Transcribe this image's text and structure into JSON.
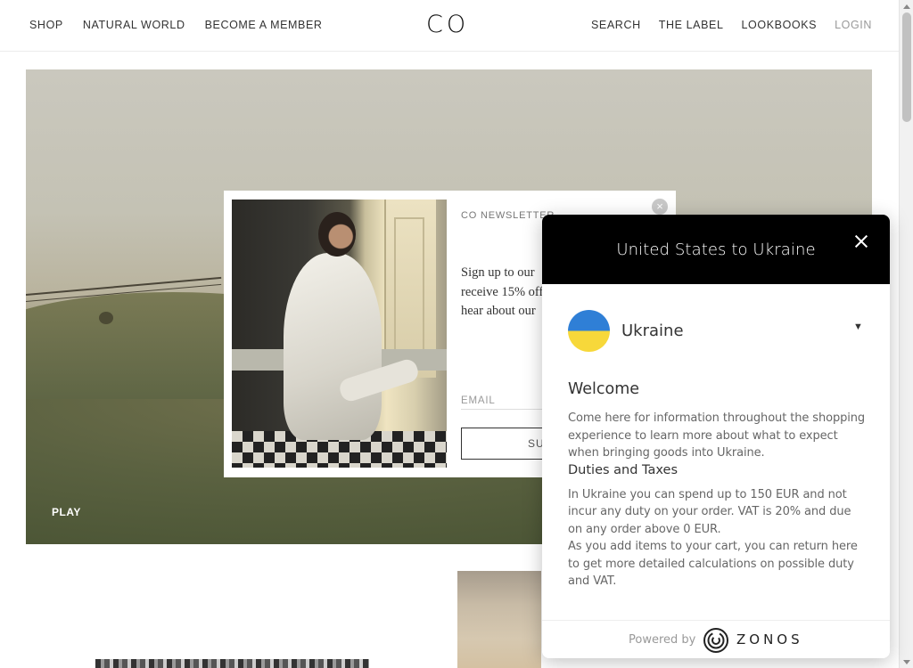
{
  "header": {
    "logo": "CO",
    "nav_left": [
      "SHOP",
      "NATURAL WORLD",
      "BECOME A MEMBER"
    ],
    "nav_right": [
      "SEARCH",
      "THE LABEL",
      "LOOKBOOKS",
      "LOGIN"
    ]
  },
  "hero": {
    "play_label": "PLAY"
  },
  "newsletter": {
    "title": "CO NEWSLETTER",
    "body_lines": [
      "Sign up to our",
      "receive 15% off",
      "hear about our"
    ],
    "email_placeholder": "EMAIL",
    "submit_label": "SUBMIT",
    "close_glyph": "×"
  },
  "zonos": {
    "title": "United States to Ukraine",
    "country": "Ukraine",
    "caret": "▼",
    "welcome_heading": "Welcome",
    "welcome_text": "Come here for information throughout the shopping experience to learn more about what to expect when bringing goods into Ukraine.",
    "duties_heading": "Duties and Taxes",
    "duties_text": "In Ukraine you can spend up to 150 EUR and not incur any duty on your order. VAT is 20% and due on any order above 0 EUR.",
    "cart_text": "As you add items to your cart, you can return here to get more detailed calculations on possible duty and VAT.",
    "powered_by": "Powered by",
    "brand": "ZONOS"
  },
  "colors": {
    "zonos_header": "#000000",
    "flag_blue": "#2f7fd6",
    "flag_yellow": "#f7d83a"
  }
}
